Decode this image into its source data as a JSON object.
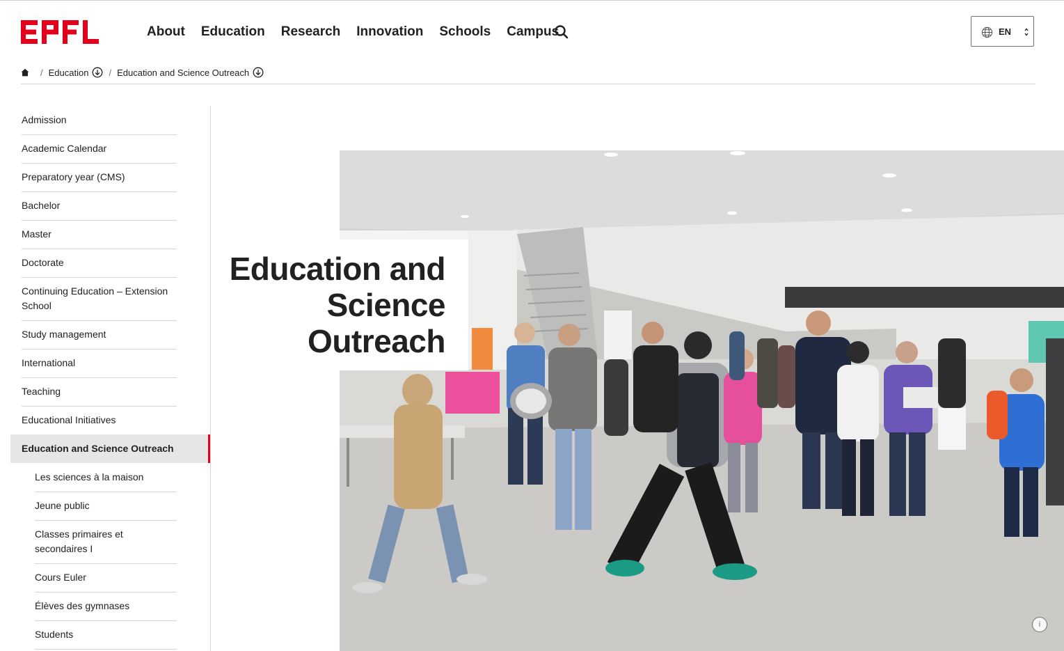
{
  "brand": {
    "logo_text": "EPFL",
    "accent": "#e2001a"
  },
  "nav": {
    "items": [
      "About",
      "Education",
      "Research",
      "Innovation",
      "Schools",
      "Campus"
    ],
    "search_icon": "search-icon"
  },
  "language": {
    "code": "EN",
    "icon": "globe-icon"
  },
  "breadcrumb": {
    "home_icon": "home-icon",
    "items": [
      "Education",
      "Education and Science Outreach"
    ]
  },
  "sidebar": {
    "items": [
      "Admission",
      "Academic Calendar",
      "Preparatory year (CMS)",
      "Bachelor",
      "Master",
      "Doctorate",
      "Continuing Education – Extension School",
      "Study management",
      "International",
      "Teaching",
      "Educational Initiatives"
    ],
    "active": "Education and Science Outreach",
    "subitems": [
      "Les sciences à la maison",
      "Jeune public",
      "Classes primaires et secondaires I",
      "Cours Euler",
      "Élèves des gymnases",
      "Students"
    ]
  },
  "hero": {
    "title": "Education and Science Outreach",
    "info_label": "i"
  }
}
